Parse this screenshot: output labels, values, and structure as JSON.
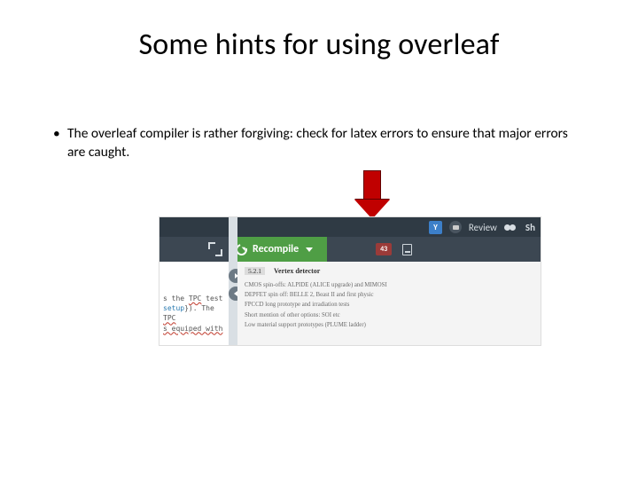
{
  "slide": {
    "title": "Some hints for using overleaf",
    "bullet": "The overleaf compiler is rather forgiving: check for latex errors to ensure that major errors are caught."
  },
  "screenshot": {
    "topstrip": {
      "user_badge": "Y",
      "review_label": "Review",
      "share_label": "Sh"
    },
    "toolbar": {
      "recompile_label": "Recompile",
      "errors_count": "43"
    },
    "code_pane": {
      "line1_a": "s the ",
      "line1_b": "TPC",
      "line1_c": " test",
      "line2_a": "setup",
      "line2_b": "}). The ",
      "line2_c": "TPC",
      "line3": "s equiped with"
    },
    "pdf_pane": {
      "secnum": "5.2.1",
      "sectitle": "Vertex detector",
      "line1": "CMOS spin-offs: ALPIDE (ALICE upgrade) and MIMOSI",
      "line2": "DEPFET spin off: BELLE 2, Beast II and first physic",
      "line3": "FPCCD long prototype and irradiation tests",
      "line4": "Short mention of other options: SOI etc",
      "line5": "Low material support prototypes (PLUME ladder)"
    }
  }
}
